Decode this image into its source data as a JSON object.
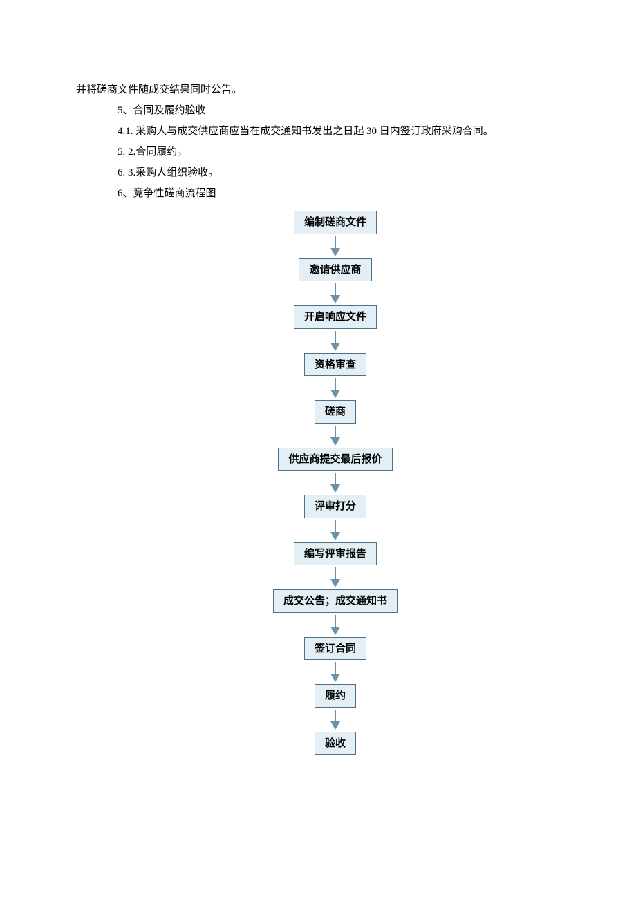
{
  "text": {
    "line1": "并将磋商文件随成交结果同时公告。",
    "line2": "5、合同及履约验收",
    "line3": "4.1.  采购人与成交供应商应当在成交通知书发出之日起 30 日内签订政府采购合同。",
    "line4": "5.      2.合同履约。",
    "line5": "6.      3.采购人组织验收。",
    "line6": "6、竞争性磋商流程图"
  },
  "flowchart": {
    "steps": [
      "编制磋商文件",
      "邀请供应商",
      "开启响应文件",
      "资格审查",
      "磋商",
      "供应商提交最后报价",
      "评审打分",
      "编写评审报告",
      "成交公告；成交通知书",
      "签订合同",
      "履约",
      "验收"
    ]
  }
}
